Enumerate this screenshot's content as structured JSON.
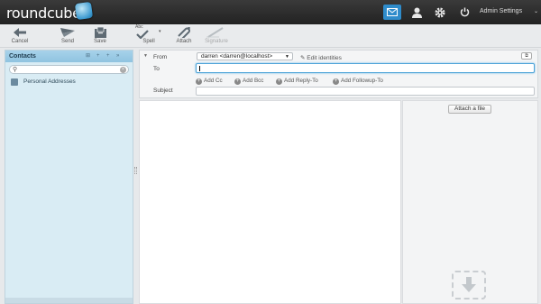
{
  "header": {
    "logo_text": "roundcube",
    "admin_settings": "Admin Settings",
    "icons": [
      "mail-icon",
      "contacts-icon",
      "settings-gear-icon",
      "logout-power-icon"
    ]
  },
  "toolbar": {
    "cancel": "Cancel",
    "send": "Send",
    "save": "Save",
    "spell": "Spell",
    "spell_badge": "Abc",
    "attach": "Attach",
    "signature": "Signature"
  },
  "sidebar": {
    "title": "Contacts",
    "address_book": "Personal Addresses"
  },
  "compose": {
    "from_label": "From",
    "from_value": "darren <darren@localhost>",
    "edit_identities": "Edit identities",
    "to_label": "To",
    "to_value": "",
    "subject_label": "Subject",
    "subject_value": "",
    "add_cc": "Add Cc",
    "add_bcc": "Add Bcc",
    "add_reply_to": "Add Reply-To",
    "add_followup_to": "Add Followup-To"
  },
  "attachments": {
    "attach_button": "Attach a file"
  },
  "colors": {
    "header_bg": "#2b2b2b",
    "accent": "#2f8ccb",
    "sidebar_bg": "#d9ecf4"
  }
}
